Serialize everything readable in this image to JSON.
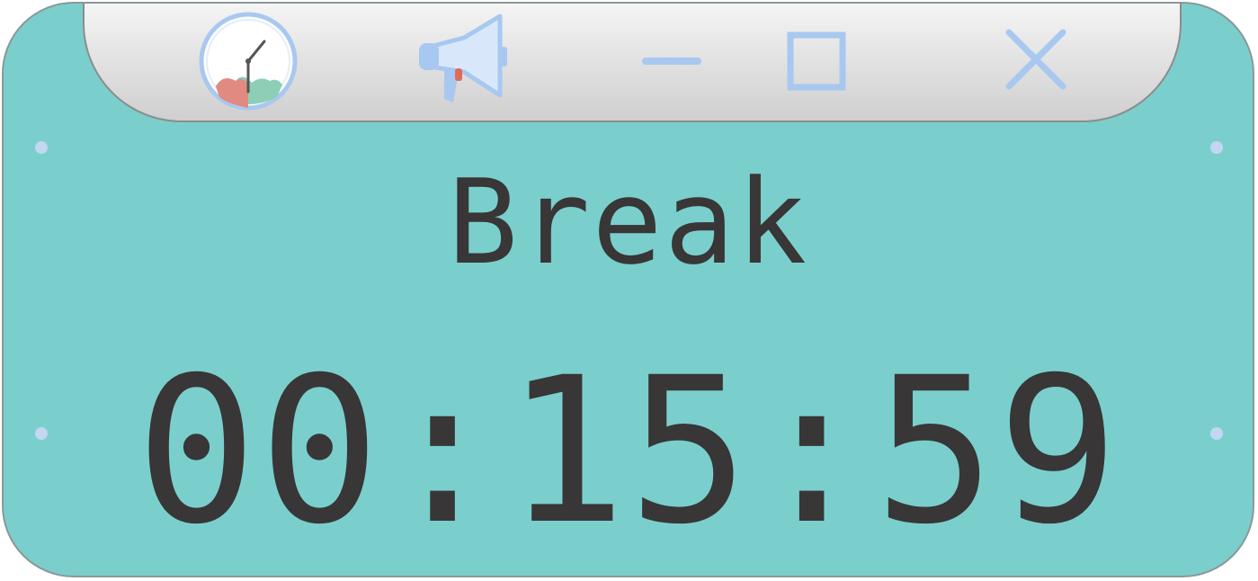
{
  "window": {
    "background_color": "#7acfcd",
    "text_color": "#383636",
    "accent_color": "#a8c8f0"
  },
  "toolbar": {
    "buttons": [
      {
        "name": "clock-button",
        "icon": "clock-icon"
      },
      {
        "name": "announce-button",
        "icon": "megaphone-icon"
      },
      {
        "name": "minimize-button",
        "icon": "minimize-icon"
      },
      {
        "name": "maximize-button",
        "icon": "maximize-icon"
      },
      {
        "name": "close-button",
        "icon": "close-icon"
      }
    ]
  },
  "timer": {
    "mode": "Break",
    "time": "00:15:59"
  }
}
